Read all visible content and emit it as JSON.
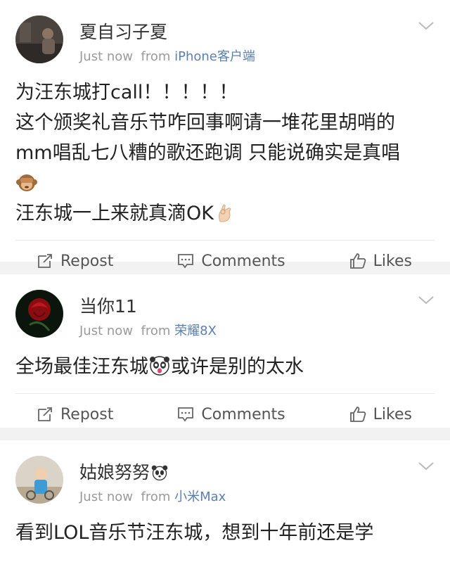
{
  "posts": [
    {
      "author": "夏自习子夏",
      "time": "Just now",
      "from_label": "from",
      "source": "iPhone客户端",
      "lines": [
        "为汪东城打call！！！！！",
        "这个颁奖礼音乐节咋回事啊请一堆花里胡哨的",
        "mm唱乱七八糟的歌还跑调 只能说确实是真唱",
        "汪东城一上来就真滴OK"
      ],
      "emojis": [
        "see-no-evil-monkey-emoji",
        "ok-hand-emoji"
      ]
    },
    {
      "author": "当你11",
      "time": "Just now",
      "from_label": "from",
      "source": "荣耀8X",
      "text_before": "全场最佳汪东城",
      "text_after": "或许是别的太水",
      "emojis": [
        "panda-face-emoji"
      ]
    },
    {
      "author": "姑娘努努",
      "time": "Just now",
      "from_label": "from",
      "source": "小米Max",
      "lines": [
        "看到LOL音乐节汪东城，想到十年前还是学"
      ],
      "emojis": [
        "panda-emoji"
      ]
    }
  ],
  "actions": {
    "repost": "Repost",
    "comments": "Comments",
    "likes": "Likes"
  },
  "icons": [
    "chevron-down-icon",
    "repost-icon",
    "comments-icon",
    "likes-icon"
  ],
  "colors": {
    "source_link": "#5b7fb0",
    "meta": "#9a9a9a",
    "divider": "#f2f2f2"
  }
}
